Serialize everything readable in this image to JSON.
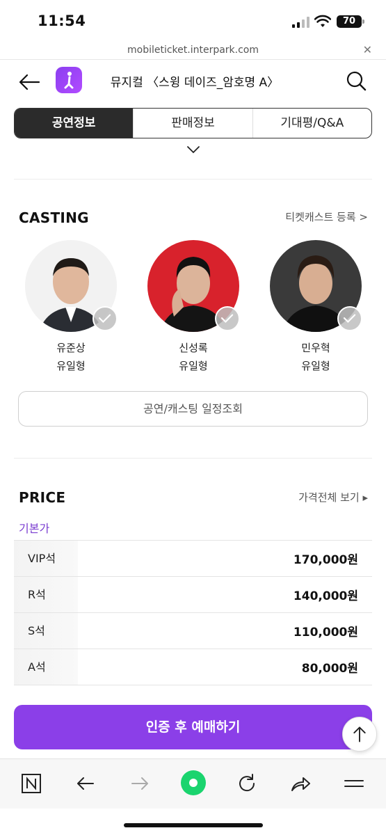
{
  "status_bar": {
    "time": "11:54",
    "battery": "70"
  },
  "browser": {
    "url": "mobileticket.interpark.com",
    "close_icon": "close-icon"
  },
  "header": {
    "title": "뮤지컬 〈스윙 데이즈_암호명 A〉",
    "back_icon": "arrow-left-icon",
    "search_icon": "search-icon"
  },
  "tabs": [
    {
      "label": "공연정보",
      "active": true
    },
    {
      "label": "판매정보",
      "active": false
    },
    {
      "label": "기대평/Q&A",
      "active": false
    }
  ],
  "casting": {
    "title": "CASTING",
    "link": "티켓캐스트 등록 >",
    "actors": [
      {
        "name": "유준상",
        "role": "유일형"
      },
      {
        "name": "신성록",
        "role": "유일형"
      },
      {
        "name": "민우혁",
        "role": "유일형"
      }
    ],
    "schedule_button": "공연/캐스팅 일정조회"
  },
  "price": {
    "title": "PRICE",
    "link": "가격전체 보기 ▸",
    "subtitle": "기본가",
    "rows": [
      {
        "grade": "VIP석",
        "value": "170,000원"
      },
      {
        "grade": "R석",
        "value": "140,000원"
      },
      {
        "grade": "S석",
        "value": "110,000원"
      },
      {
        "grade": "A석",
        "value": "80,000원"
      }
    ]
  },
  "buy_button": "인증 후 예매하기",
  "colors": {
    "accent": "#8b3fe8",
    "tab_active": "#2b2b2b",
    "subtitle": "#7a3dd0"
  }
}
